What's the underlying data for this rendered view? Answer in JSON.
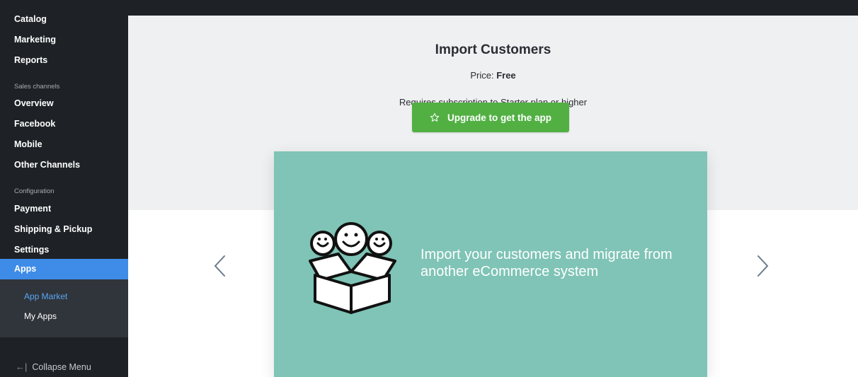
{
  "sidebar": {
    "items_top": [
      "Catalog",
      "Marketing",
      "Reports"
    ],
    "section_sales": "Sales channels",
    "items_sales": [
      "Overview",
      "Facebook",
      "Mobile",
      "Other Channels"
    ],
    "section_config": "Configuration",
    "items_config": [
      "Payment",
      "Shipping & Pickup",
      "Settings"
    ],
    "active_item": "Apps",
    "sub_items": [
      "App Market",
      "My Apps"
    ],
    "collapse_label": "Collapse Menu"
  },
  "app": {
    "title": "Import Customers",
    "price_label": "Price:",
    "price_value": "Free",
    "requirement": "Requires subscription to Starter plan or higher",
    "upgrade_button": "Upgrade to get the app",
    "upgrade_icon": "star-outline-icon"
  },
  "carousel": {
    "slide_text": "Import your customers and migrate from another eCommerce system",
    "illustration": "box-with-people-icon",
    "prev_icon": "chevron-left-icon",
    "next_icon": "chevron-right-icon"
  },
  "colors": {
    "sidebar_bg": "#1e2226",
    "active_bg": "#3f8ce8",
    "submenu_bg": "#30353b",
    "submenu_active_text": "#5aa5f5",
    "header_bg": "#eff0f2",
    "button_green": "#52b043",
    "slide_teal": "#7fc4b6"
  }
}
